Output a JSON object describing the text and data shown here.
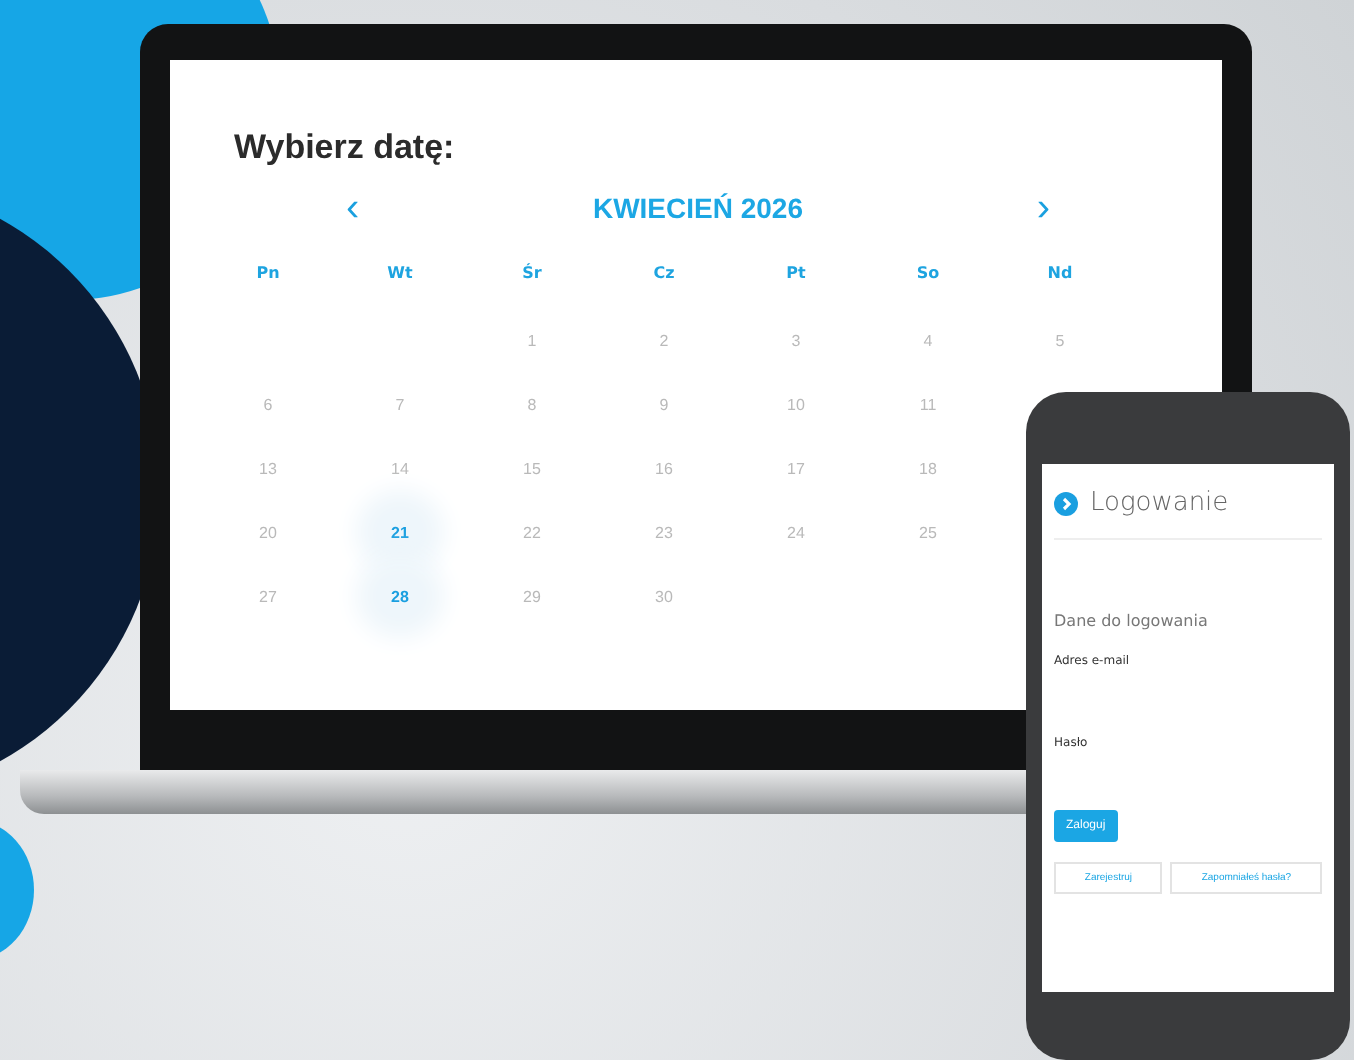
{
  "calendar": {
    "title": "Wybierz datę:",
    "prev": "‹",
    "month": "KWIECIEŃ 2026",
    "next": "›",
    "weekdays": [
      "Pn",
      "Wt",
      "Śr",
      "Cz",
      "Pt",
      "So",
      "Nd"
    ],
    "weeks": [
      [
        {
          "day": "1",
          "selected": false
        },
        {
          "day": "2",
          "selected": false
        },
        {
          "day": "3",
          "selected": false
        },
        {
          "day": "4",
          "selected": false
        },
        {
          "day": "5",
          "selected": false
        }
      ],
      [
        {
          "day": "6",
          "selected": false
        },
        {
          "day": "7",
          "selected": false
        },
        {
          "day": "8",
          "selected": false
        },
        {
          "day": "9",
          "selected": false
        },
        {
          "day": "10",
          "selected": false
        },
        {
          "day": "11",
          "selected": false
        }
      ],
      [
        {
          "day": "13",
          "selected": false
        },
        {
          "day": "14",
          "selected": false
        },
        {
          "day": "15",
          "selected": false
        },
        {
          "day": "16",
          "selected": false
        },
        {
          "day": "17",
          "selected": false
        },
        {
          "day": "18",
          "selected": false
        }
      ],
      [
        {
          "day": "20",
          "selected": false
        },
        {
          "day": "21",
          "selected": true
        },
        {
          "day": "22",
          "selected": false
        },
        {
          "day": "23",
          "selected": false
        },
        {
          "day": "24",
          "selected": false
        },
        {
          "day": "25",
          "selected": false
        }
      ],
      [
        {
          "day": "27",
          "selected": false
        },
        {
          "day": "28",
          "selected": true
        },
        {
          "day": "29",
          "selected": false
        },
        {
          "day": "30",
          "selected": false
        }
      ]
    ]
  },
  "login": {
    "title": "Logowanie",
    "section": "Dane do logowania",
    "email_label": "Adres e-mail",
    "password_label": "Hasło",
    "submit": "Zaloguj",
    "links": [
      "Zarejestruj",
      "Zapomniałeś hasła?"
    ]
  }
}
